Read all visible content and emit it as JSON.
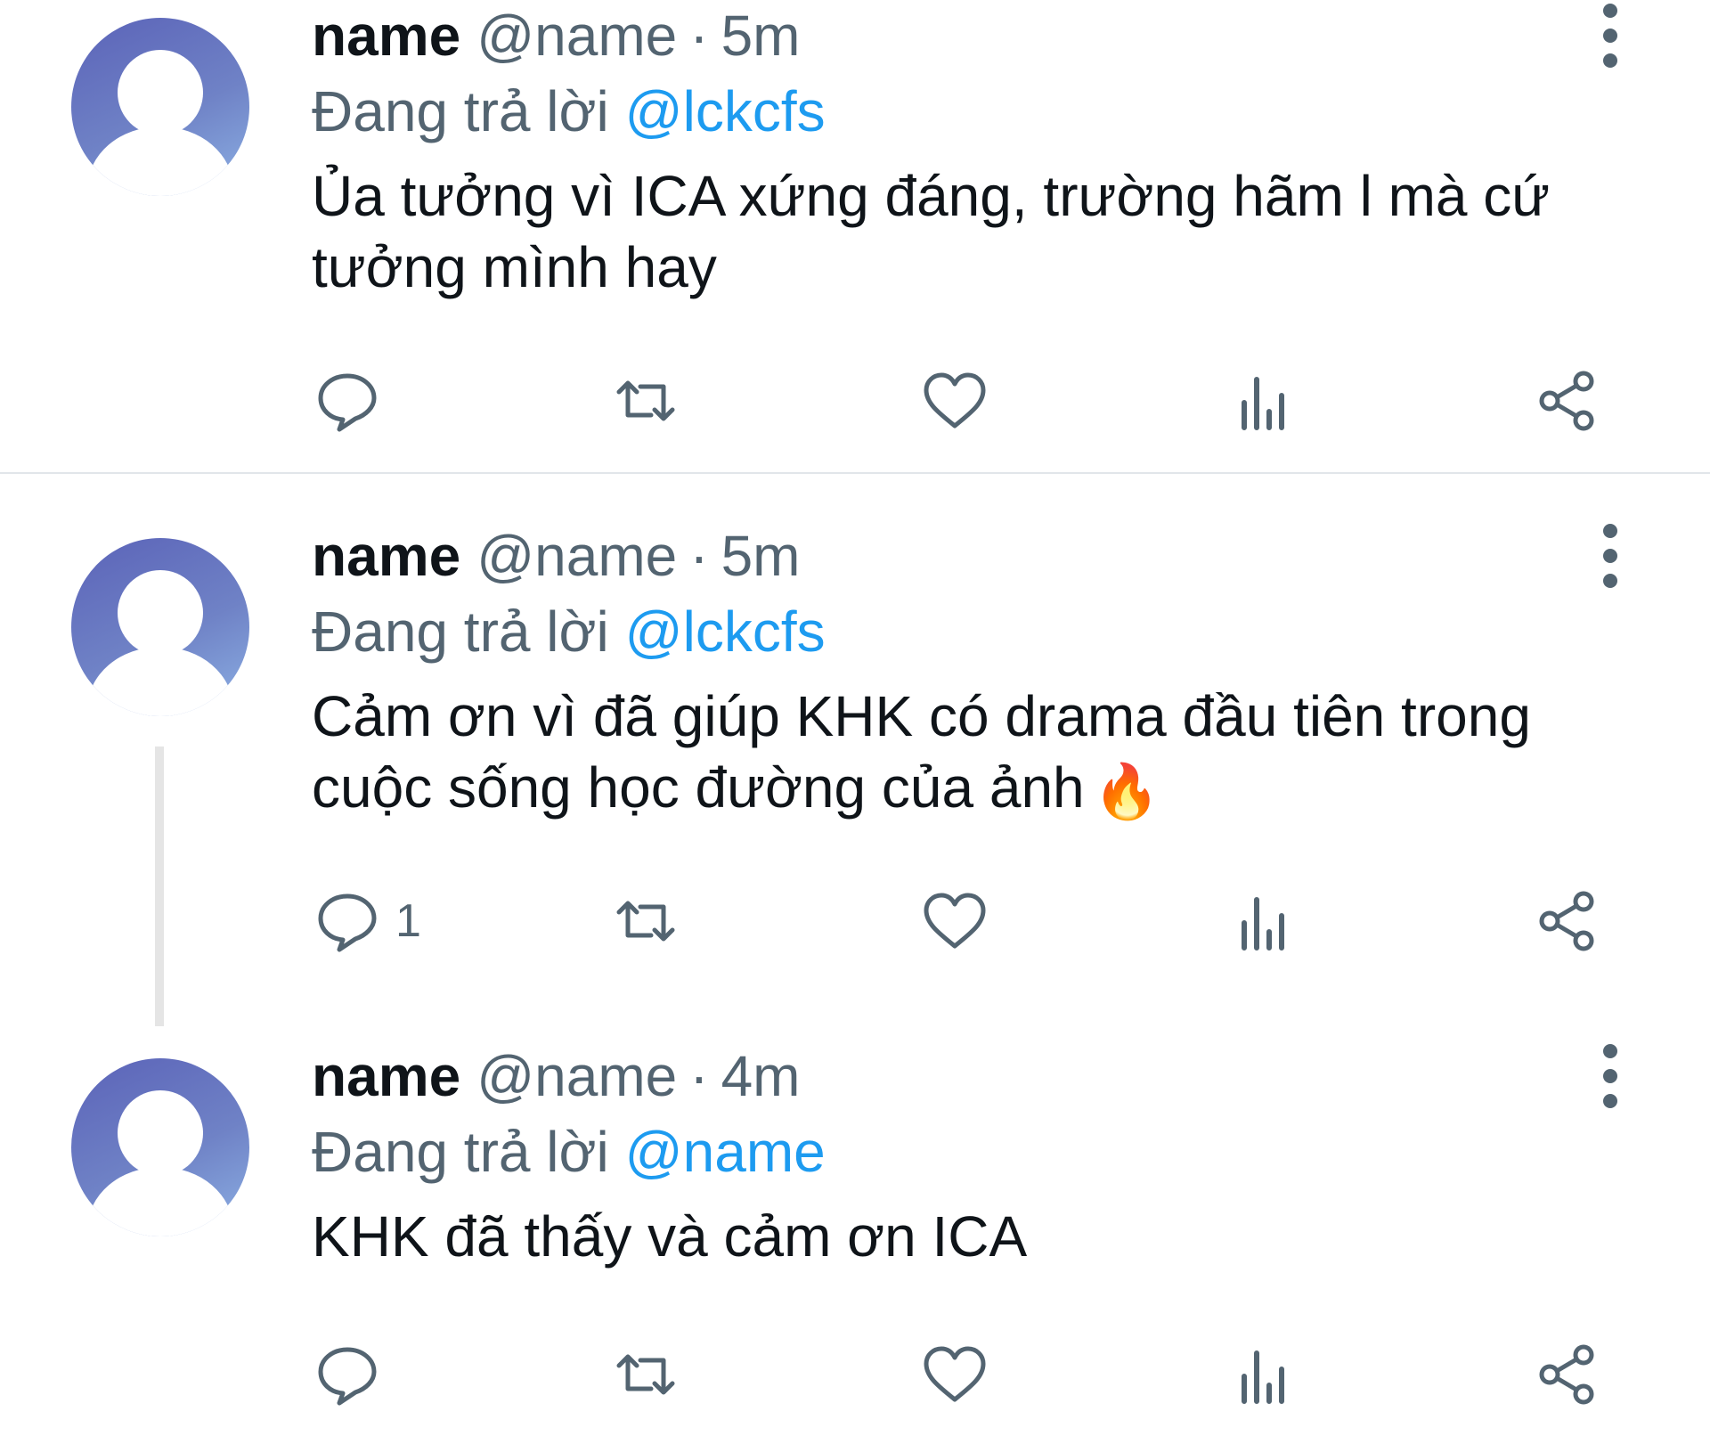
{
  "tweets": [
    {
      "name": "name",
      "handle": "@name",
      "dot": "·",
      "time": "5m",
      "reply_prefix": "Đang trả lời",
      "reply_to": "@lckcfs",
      "text": "Ủa tưởng vì ICA xứng đáng, trường hãm l mà cứ tưởng mình hay",
      "reply_count": "",
      "emoji": ""
    },
    {
      "name": "name",
      "handle": "@name",
      "dot": "·",
      "time": "5m",
      "reply_prefix": "Đang trả lời",
      "reply_to": "@lckcfs",
      "text": "Cảm ơn vì đã giúp KHK có drama đầu tiên trong cuộc sống học đường của ảnh",
      "reply_count": "1",
      "emoji": "🔥"
    },
    {
      "name": "name",
      "handle": "@name",
      "dot": "·",
      "time": "4m",
      "reply_prefix": "Đang trả lời",
      "reply_to": "@name",
      "text": "KHK đã thấy và cảm ơn ICA",
      "reply_count": "",
      "emoji": ""
    }
  ],
  "icons": [
    "more-vertical-icon",
    "reply-icon",
    "retweet-icon",
    "like-icon",
    "views-icon",
    "share-icon"
  ],
  "colors": {
    "mention": "#1d9bf0",
    "secondary": "#536471",
    "primary_text": "#0f1419",
    "avatar_gradient": [
      "#5b63b8",
      "#8db1e4"
    ]
  }
}
